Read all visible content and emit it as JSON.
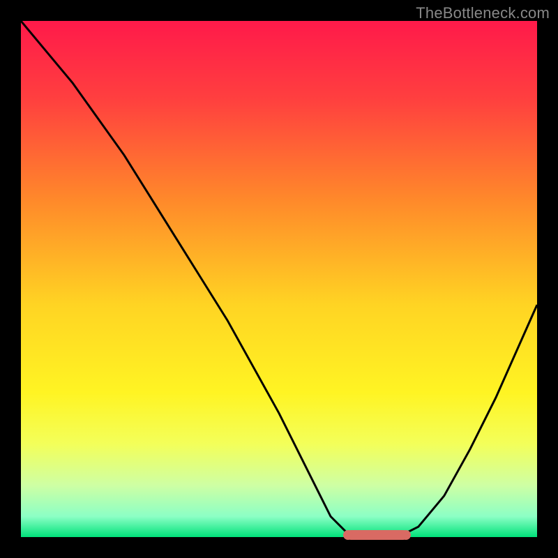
{
  "watermark": "TheBottleneck.com",
  "chart_data": {
    "type": "line",
    "title": "",
    "xlabel": "",
    "ylabel": "",
    "xlim": [
      0,
      100
    ],
    "ylim": [
      0,
      100
    ],
    "grid": false,
    "legend": false,
    "background_gradient_stops": [
      {
        "offset": 0.0,
        "color": "#ff1a4a"
      },
      {
        "offset": 0.15,
        "color": "#ff3f3f"
      },
      {
        "offset": 0.35,
        "color": "#ff8a2a"
      },
      {
        "offset": 0.55,
        "color": "#ffd423"
      },
      {
        "offset": 0.72,
        "color": "#fff423"
      },
      {
        "offset": 0.82,
        "color": "#f3ff5a"
      },
      {
        "offset": 0.9,
        "color": "#ceffa4"
      },
      {
        "offset": 0.96,
        "color": "#8cffc5"
      },
      {
        "offset": 1.0,
        "color": "#00e27a"
      }
    ],
    "series": [
      {
        "name": "bottleneck-curve",
        "stroke": "#000000",
        "x": [
          0,
          5,
          10,
          15,
          20,
          25,
          30,
          35,
          40,
          45,
          50,
          55,
          58,
          60,
          63,
          67,
          70,
          73,
          77,
          82,
          87,
          92,
          96,
          100
        ],
        "y": [
          100,
          94,
          88,
          81,
          74,
          66,
          58,
          50,
          42,
          33,
          24,
          14,
          8,
          4,
          1,
          0,
          0,
          0,
          2,
          8,
          17,
          27,
          36,
          45
        ]
      }
    ],
    "trough_marker": {
      "color": "#d96a63",
      "x_start": 63,
      "x_end": 75,
      "y": 0
    }
  }
}
